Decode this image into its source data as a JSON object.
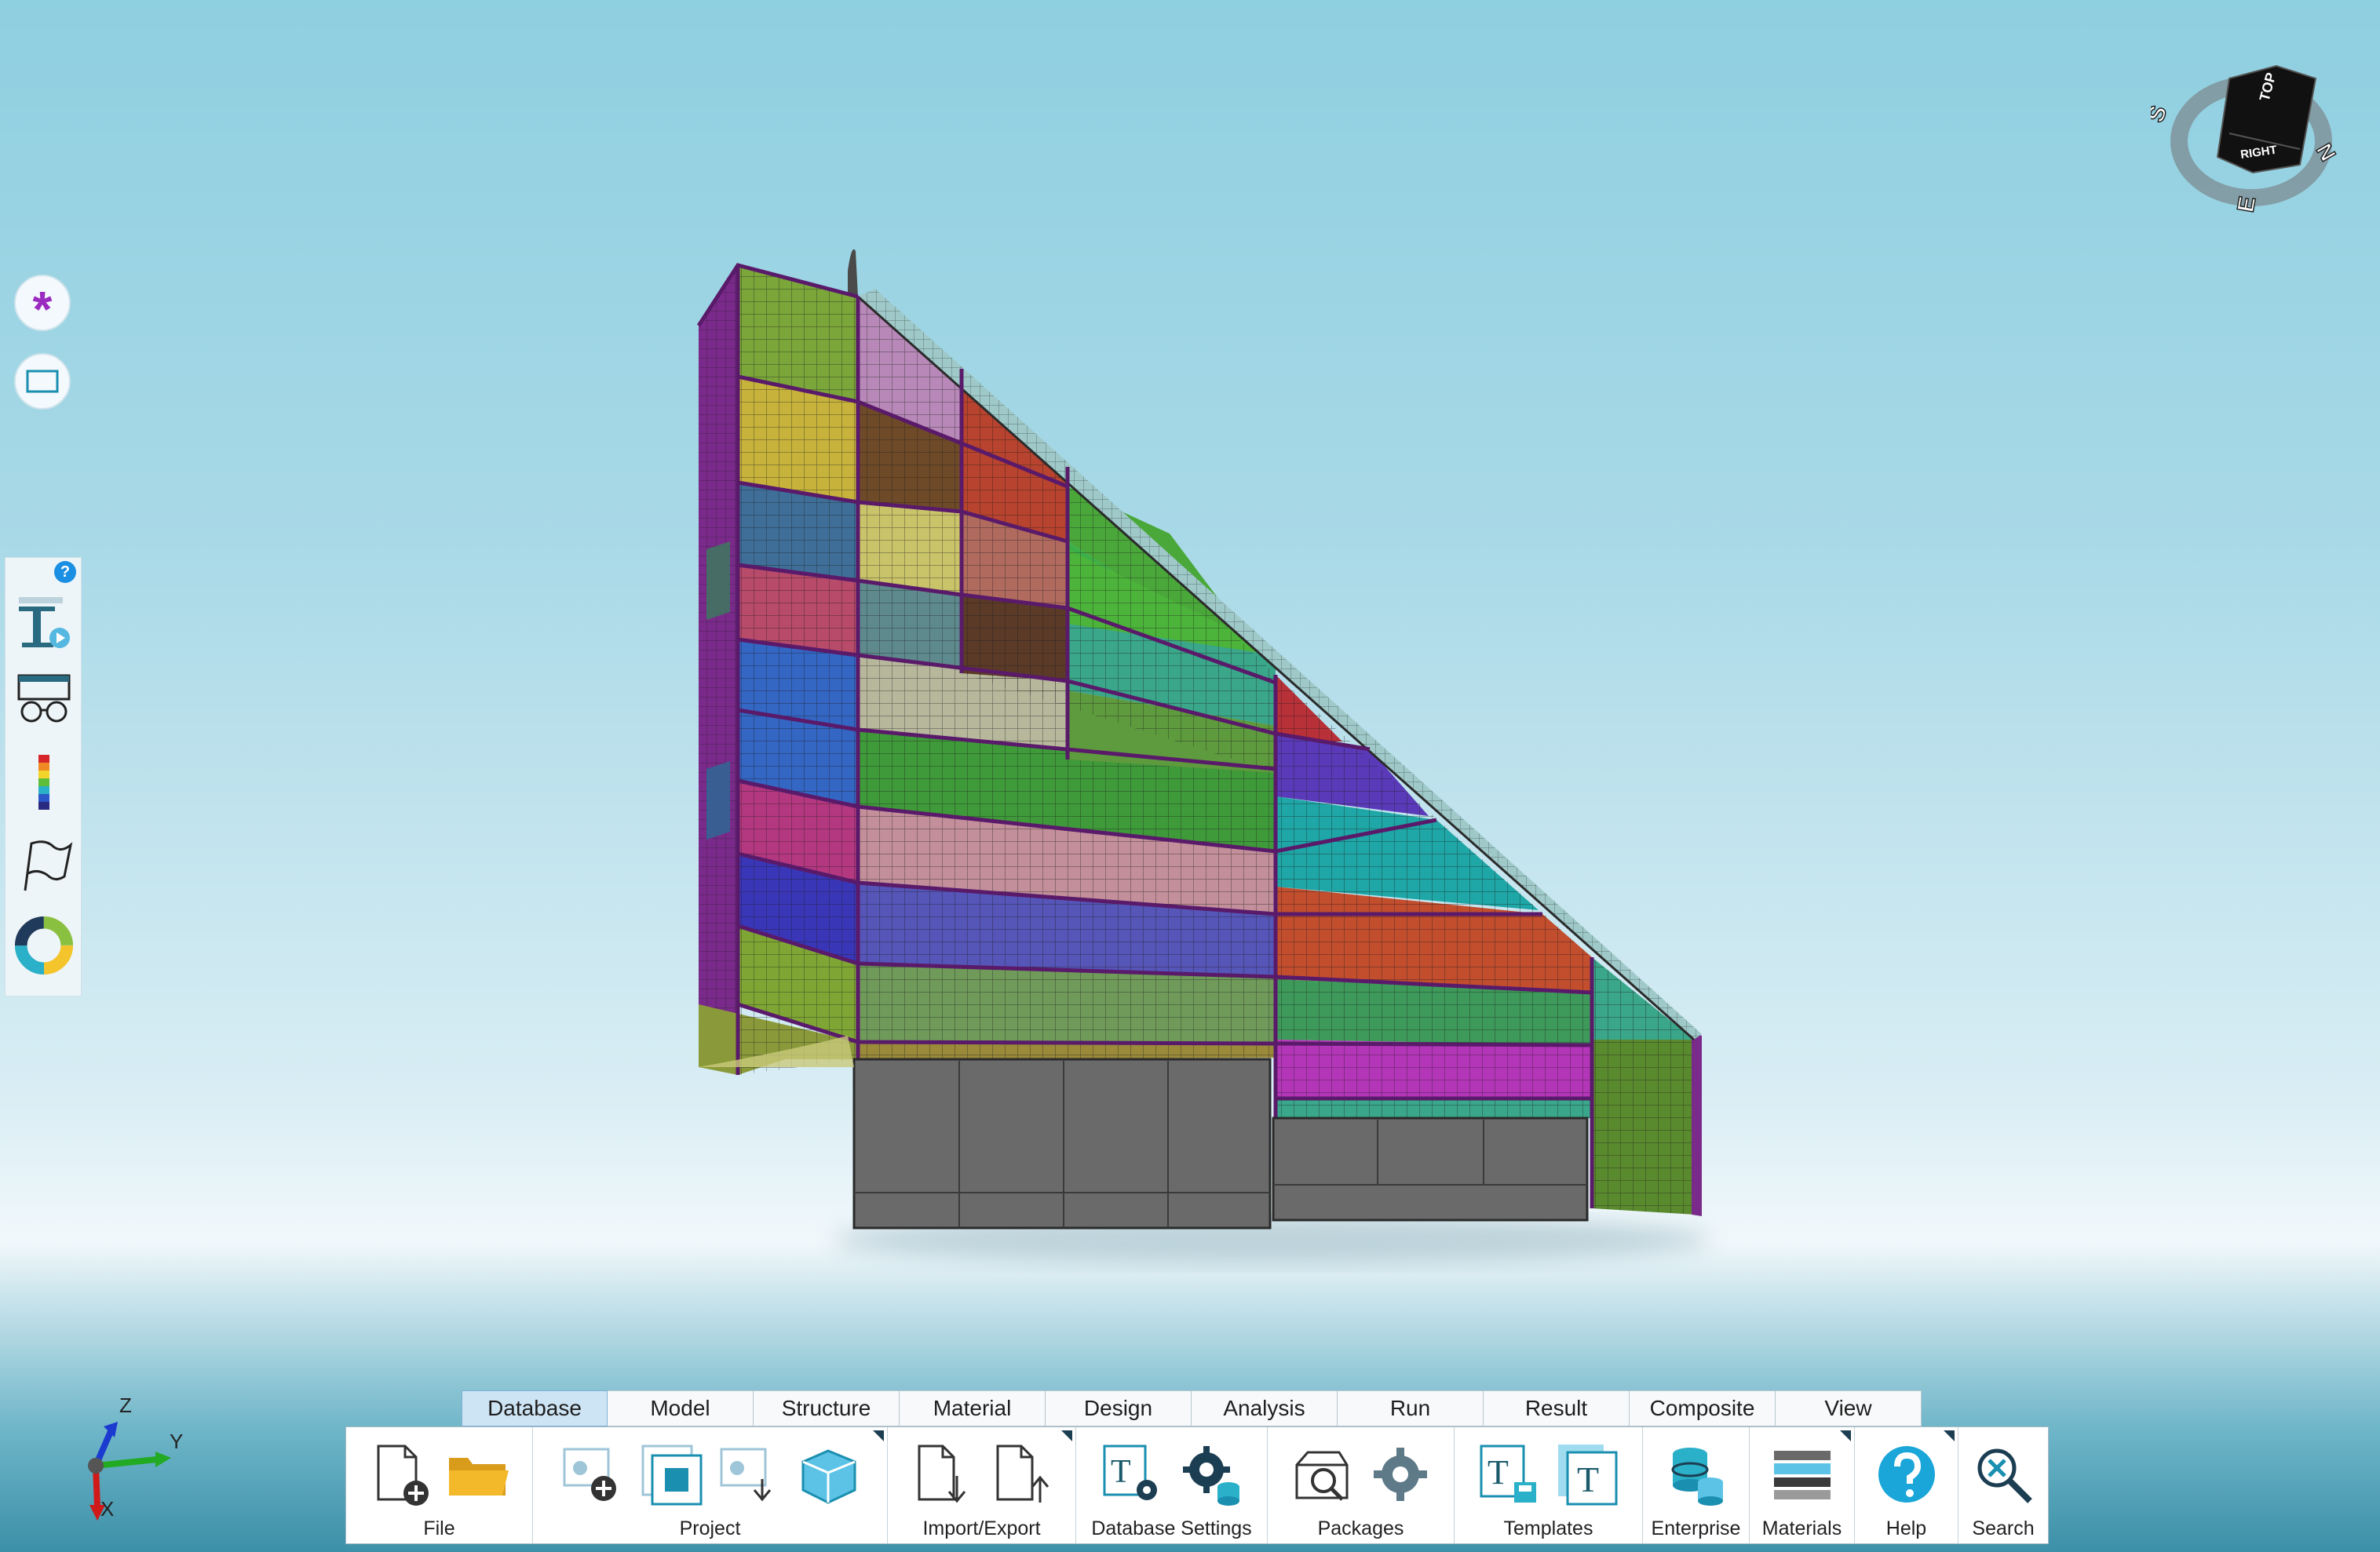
{
  "ribbon": {
    "tabs": [
      {
        "label": "Database",
        "active": true
      },
      {
        "label": "Model",
        "active": false
      },
      {
        "label": "Structure",
        "active": false
      },
      {
        "label": "Material",
        "active": false
      },
      {
        "label": "Design",
        "active": false
      },
      {
        "label": "Analysis",
        "active": false
      },
      {
        "label": "Run",
        "active": false
      },
      {
        "label": "Result",
        "active": false
      },
      {
        "label": "Composite",
        "active": false
      },
      {
        "label": "View",
        "active": false
      }
    ],
    "groups": {
      "file": "File",
      "project": "Project",
      "import_export": "Import/Export",
      "database_settings": "Database Settings",
      "packages": "Packages",
      "templates": "Templates",
      "enterprise": "Enterprise",
      "materials": "Materials",
      "help": "Help",
      "search": "Search"
    }
  },
  "nav_cube": {
    "top": "TOP",
    "right": "RIGHT",
    "compass_s": "S",
    "compass_n": "N",
    "compass_e": "E"
  },
  "axis_triad": {
    "z": "Z",
    "y": "Y",
    "x": "X"
  },
  "left_panel": {
    "help_badge": "?"
  },
  "colors": {
    "accent": "#1a8fe3",
    "active_tab": "#cde4f4",
    "mesh_edge": "#5a1a6a"
  }
}
